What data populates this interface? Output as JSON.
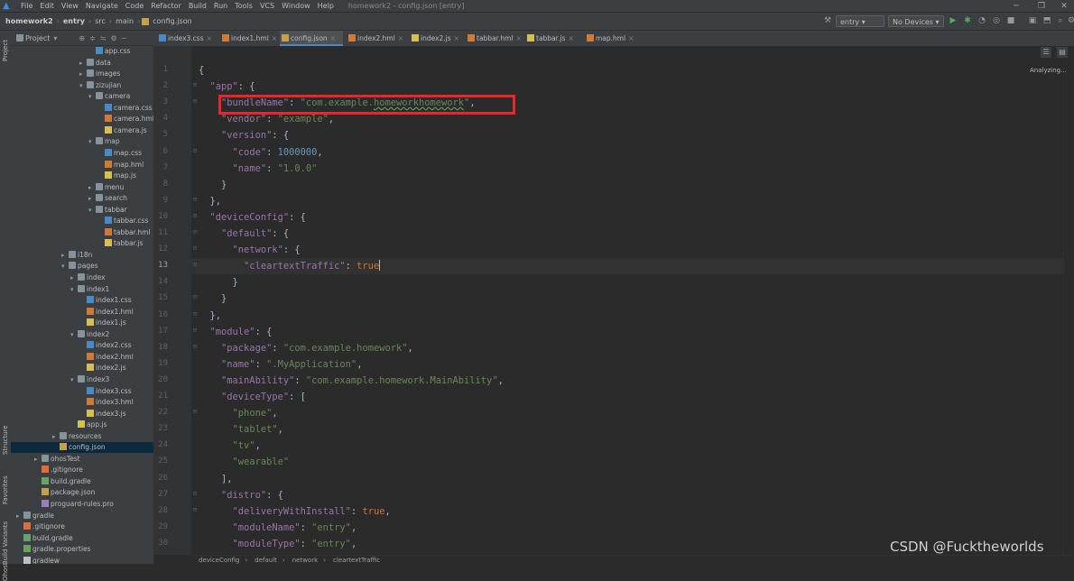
{
  "menubar": {
    "items": [
      "File",
      "Edit",
      "View",
      "Navigate",
      "Code",
      "Refactor",
      "Build",
      "Run",
      "Tools",
      "VCS",
      "Window",
      "Help"
    ],
    "window_title": "homework2 - config.json [entry]"
  },
  "navbar": {
    "crumbs": [
      "homework2",
      "entry",
      "src",
      "main",
      "config.json"
    ],
    "run_config": "entry",
    "device": "No Devices"
  },
  "project_panel": {
    "title": "Project",
    "side_tabs": [
      "Project",
      "Structure",
      "Favorites",
      "OhosBuild Variants"
    ]
  },
  "tree": [
    {
      "label": "app.css",
      "indent": 9,
      "icon": "css",
      "arrow": ""
    },
    {
      "label": "data",
      "indent": 8,
      "icon": "folder",
      "arrow": "▸"
    },
    {
      "label": "images",
      "indent": 8,
      "icon": "folder",
      "arrow": "▸"
    },
    {
      "label": "zizujian",
      "indent": 8,
      "icon": "folder",
      "arrow": "▾"
    },
    {
      "label": "camera",
      "indent": 9,
      "icon": "folder",
      "arrow": "▾"
    },
    {
      "label": "camera.css",
      "indent": 10,
      "icon": "css",
      "arrow": ""
    },
    {
      "label": "camera.hml",
      "indent": 10,
      "icon": "hml",
      "arrow": ""
    },
    {
      "label": "camera.js",
      "indent": 10,
      "icon": "js",
      "arrow": ""
    },
    {
      "label": "map",
      "indent": 9,
      "icon": "folder",
      "arrow": "▾"
    },
    {
      "label": "map.css",
      "indent": 10,
      "icon": "css",
      "arrow": ""
    },
    {
      "label": "map.hml",
      "indent": 10,
      "icon": "hml",
      "arrow": ""
    },
    {
      "label": "map.js",
      "indent": 10,
      "icon": "js",
      "arrow": ""
    },
    {
      "label": "menu",
      "indent": 9,
      "icon": "folder",
      "arrow": "▸"
    },
    {
      "label": "search",
      "indent": 9,
      "icon": "folder",
      "arrow": "▸"
    },
    {
      "label": "tabbar",
      "indent": 9,
      "icon": "folder",
      "arrow": "▾"
    },
    {
      "label": "tabbar.css",
      "indent": 10,
      "icon": "css",
      "arrow": ""
    },
    {
      "label": "tabbar.hml",
      "indent": 10,
      "icon": "hml",
      "arrow": ""
    },
    {
      "label": "tabbar.js",
      "indent": 10,
      "icon": "js",
      "arrow": ""
    },
    {
      "label": "i18n",
      "indent": 6,
      "icon": "folder",
      "arrow": "▸"
    },
    {
      "label": "pages",
      "indent": 6,
      "icon": "folder",
      "arrow": "▾"
    },
    {
      "label": "index",
      "indent": 7,
      "icon": "folder",
      "arrow": "▸"
    },
    {
      "label": "index1",
      "indent": 7,
      "icon": "folder",
      "arrow": "▾"
    },
    {
      "label": "index1.css",
      "indent": 8,
      "icon": "css",
      "arrow": ""
    },
    {
      "label": "index1.hml",
      "indent": 8,
      "icon": "hml",
      "arrow": ""
    },
    {
      "label": "index1.js",
      "indent": 8,
      "icon": "js",
      "arrow": ""
    },
    {
      "label": "index2",
      "indent": 7,
      "icon": "folder",
      "arrow": "▾"
    },
    {
      "label": "index2.css",
      "indent": 8,
      "icon": "css",
      "arrow": ""
    },
    {
      "label": "index2.hml",
      "indent": 8,
      "icon": "hml",
      "arrow": ""
    },
    {
      "label": "index2.js",
      "indent": 8,
      "icon": "js",
      "arrow": ""
    },
    {
      "label": "index3",
      "indent": 7,
      "icon": "folder",
      "arrow": "▾"
    },
    {
      "label": "index3.css",
      "indent": 8,
      "icon": "css",
      "arrow": ""
    },
    {
      "label": "index3.hml",
      "indent": 8,
      "icon": "hml",
      "arrow": ""
    },
    {
      "label": "index3.js",
      "indent": 8,
      "icon": "js",
      "arrow": ""
    },
    {
      "label": "app.js",
      "indent": 7,
      "icon": "js",
      "arrow": ""
    },
    {
      "label": "resources",
      "indent": 5,
      "icon": "folder",
      "arrow": "▸"
    },
    {
      "label": "config.json",
      "indent": 5,
      "icon": "json",
      "arrow": "",
      "selected": true
    },
    {
      "label": "ohosTest",
      "indent": 3,
      "icon": "folder",
      "arrow": "▸"
    },
    {
      "label": ".gitignore",
      "indent": 3,
      "icon": "git",
      "arrow": ""
    },
    {
      "label": "build.gradle",
      "indent": 3,
      "icon": "grad",
      "arrow": ""
    },
    {
      "label": "package.json",
      "indent": 3,
      "icon": "json",
      "arrow": ""
    },
    {
      "label": "proguard-rules.pro",
      "indent": 3,
      "icon": "pro",
      "arrow": ""
    },
    {
      "label": "gradle",
      "indent": 1,
      "icon": "folder",
      "arrow": "▸"
    },
    {
      "label": ".gitignore",
      "indent": 1,
      "icon": "git",
      "arrow": ""
    },
    {
      "label": "build.gradle",
      "indent": 1,
      "icon": "grad",
      "arrow": ""
    },
    {
      "label": "gradle.properties",
      "indent": 1,
      "icon": "grad",
      "arrow": ""
    },
    {
      "label": "gradlew",
      "indent": 1,
      "icon": "file",
      "arrow": ""
    }
  ],
  "tabs": [
    {
      "label": "index3.css",
      "icon": "css"
    },
    {
      "label": "index1.hml",
      "icon": "hml"
    },
    {
      "label": "config.json",
      "icon": "json",
      "active": true
    },
    {
      "label": "index2.hml",
      "icon": "hml"
    },
    {
      "label": "index2.js",
      "icon": "js"
    },
    {
      "label": "tabbar.hml",
      "icon": "hml"
    },
    {
      "label": "tabbar.js",
      "icon": "js"
    },
    {
      "label": "map.hml",
      "icon": "hml"
    }
  ],
  "editor": {
    "status": "Analyzing...",
    "current_line": 13,
    "lines": [
      [
        [
          "p",
          "{"
        ]
      ],
      [
        [
          "p",
          "  "
        ],
        [
          "k",
          "\"app\""
        ],
        [
          "p",
          ": {"
        ]
      ],
      [
        [
          "p",
          "    "
        ],
        [
          "k",
          "\"bundleName\""
        ],
        [
          "p",
          ": "
        ],
        [
          "s",
          "\"com.example."
        ],
        [
          "sw",
          "homeworkhomework"
        ],
        [
          "s",
          "\""
        ],
        [
          "p",
          ","
        ]
      ],
      [
        [
          "p",
          "    "
        ],
        [
          "k",
          "\"vendor\""
        ],
        [
          "p",
          ": "
        ],
        [
          "s",
          "\"example\""
        ],
        [
          "p",
          ","
        ]
      ],
      [
        [
          "p",
          "    "
        ],
        [
          "k",
          "\"version\""
        ],
        [
          "p",
          ": {"
        ]
      ],
      [
        [
          "p",
          "      "
        ],
        [
          "k",
          "\"code\""
        ],
        [
          "p",
          ": "
        ],
        [
          "n",
          "1000000"
        ],
        [
          "p",
          ","
        ]
      ],
      [
        [
          "p",
          "      "
        ],
        [
          "k",
          "\"name\""
        ],
        [
          "p",
          ": "
        ],
        [
          "s",
          "\"1.0.0\""
        ]
      ],
      [
        [
          "p",
          "    }"
        ]
      ],
      [
        [
          "p",
          "  },"
        ]
      ],
      [
        [
          "p",
          "  "
        ],
        [
          "k",
          "\"deviceConfig\""
        ],
        [
          "p",
          ": {"
        ]
      ],
      [
        [
          "p",
          "    "
        ],
        [
          "k",
          "\"default\""
        ],
        [
          "p",
          ": {"
        ]
      ],
      [
        [
          "p",
          "      "
        ],
        [
          "k",
          "\"network\""
        ],
        [
          "p",
          ": {"
        ]
      ],
      [
        [
          "p",
          "        "
        ],
        [
          "k",
          "\"cleartextTraffic\""
        ],
        [
          "p",
          ": "
        ],
        [
          "b",
          "true"
        ],
        [
          "c",
          ""
        ]
      ],
      [
        [
          "p",
          "      }"
        ]
      ],
      [
        [
          "p",
          "    }"
        ]
      ],
      [
        [
          "p",
          "  },"
        ]
      ],
      [
        [
          "p",
          "  "
        ],
        [
          "k",
          "\"module\""
        ],
        [
          "p",
          ": {"
        ]
      ],
      [
        [
          "p",
          "    "
        ],
        [
          "k",
          "\"package\""
        ],
        [
          "p",
          ": "
        ],
        [
          "s",
          "\"com.example.homework\""
        ],
        [
          "p",
          ","
        ]
      ],
      [
        [
          "p",
          "    "
        ],
        [
          "k",
          "\"name\""
        ],
        [
          "p",
          ": "
        ],
        [
          "s",
          "\".MyApplication\""
        ],
        [
          "p",
          ","
        ]
      ],
      [
        [
          "p",
          "    "
        ],
        [
          "k",
          "\"mainAbility\""
        ],
        [
          "p",
          ": "
        ],
        [
          "s",
          "\"com.example.homework.MainAbility\""
        ],
        [
          "p",
          ","
        ]
      ],
      [
        [
          "p",
          "    "
        ],
        [
          "k",
          "\"deviceType\""
        ],
        [
          "p",
          ": ["
        ]
      ],
      [
        [
          "p",
          "      "
        ],
        [
          "s",
          "\"phone\""
        ],
        [
          "p",
          ","
        ]
      ],
      [
        [
          "p",
          "      "
        ],
        [
          "s",
          "\"tablet\""
        ],
        [
          "p",
          ","
        ]
      ],
      [
        [
          "p",
          "      "
        ],
        [
          "s",
          "\"tv\""
        ],
        [
          "p",
          ","
        ]
      ],
      [
        [
          "p",
          "      "
        ],
        [
          "s",
          "\"wearable\""
        ]
      ],
      [
        [
          "p",
          "    ],"
        ]
      ],
      [
        [
          "p",
          "    "
        ],
        [
          "k",
          "\"distro\""
        ],
        [
          "p",
          ": {"
        ]
      ],
      [
        [
          "p",
          "      "
        ],
        [
          "k",
          "\"deliveryWithInstall\""
        ],
        [
          "p",
          ": "
        ],
        [
          "b",
          "true"
        ],
        [
          "p",
          ","
        ]
      ],
      [
        [
          "p",
          "      "
        ],
        [
          "k",
          "\"moduleName\""
        ],
        [
          "p",
          ": "
        ],
        [
          "s",
          "\"entry\""
        ],
        [
          "p",
          ","
        ]
      ],
      [
        [
          "p",
          "      "
        ],
        [
          "k",
          "\"moduleType\""
        ],
        [
          "p",
          ": "
        ],
        [
          "s",
          "\"entry\""
        ],
        [
          "p",
          ","
        ]
      ]
    ],
    "folds": [
      1,
      2,
      5,
      8,
      9,
      10,
      11,
      12,
      14,
      15,
      16,
      17,
      21,
      26,
      27
    ]
  },
  "breadcrumb_footer": [
    "deviceConfig",
    "default",
    "network",
    "cleartextTraffic"
  ],
  "watermark": "CSDN @Fucktheworlds",
  "colors": {
    "highlight_box": "#e8262c",
    "accent": "#4a88c7"
  }
}
